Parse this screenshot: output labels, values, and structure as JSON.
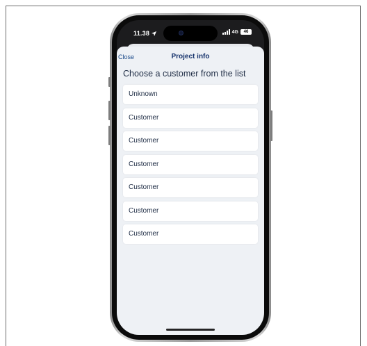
{
  "status_bar": {
    "time": "11.38",
    "location_icon": "location-arrow-icon",
    "network": "4G",
    "battery": "46"
  },
  "nav": {
    "close_label": "Close",
    "title": "Project info"
  },
  "heading": "Choose a customer from the list",
  "customers": [
    "Unknown",
    "Customer",
    "Customer",
    "Customer",
    "Customer",
    "Customer",
    "Customer"
  ],
  "colors": {
    "accent": "#14316b",
    "sheet_background": "#eef1f5",
    "card_background": "#ffffff"
  }
}
